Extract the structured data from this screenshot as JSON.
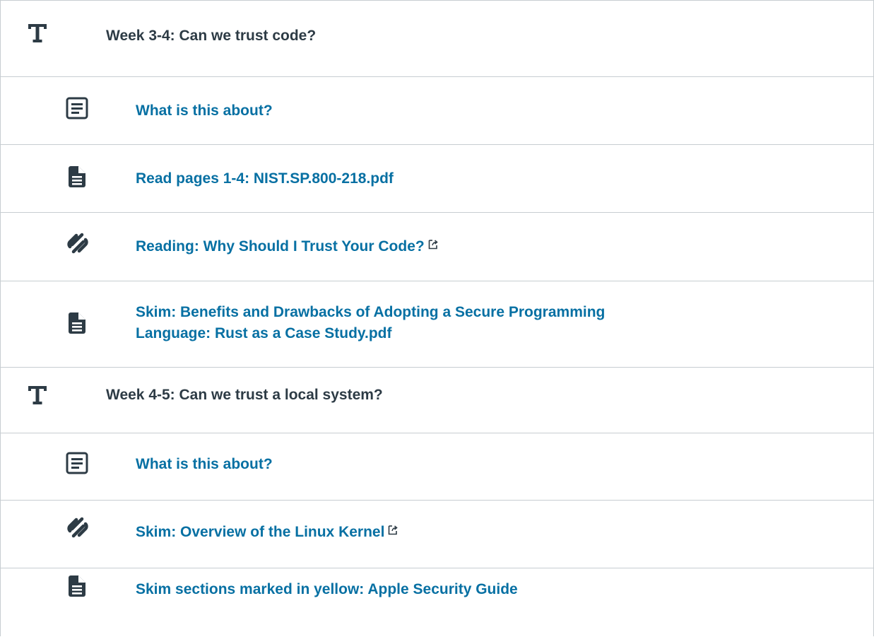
{
  "module": {
    "rows": [
      {
        "kind": "header",
        "icon": "text-header-icon",
        "title": "Week 3-4: Can we trust code?"
      },
      {
        "kind": "item",
        "icon": "page-icon",
        "title": "What is this about?"
      },
      {
        "kind": "item",
        "icon": "file-icon",
        "title": "Read pages 1-4: NIST.SP.800-218.pdf"
      },
      {
        "kind": "item",
        "icon": "external-link-icon",
        "title": "Reading: Why Should I Trust Your Code?",
        "external": true
      },
      {
        "kind": "item",
        "icon": "file-icon",
        "title_line1": "Skim: Benefits and Drawbacks of Adopting a Secure Programming",
        "title_line2": "Language: Rust as a Case Study.pdf"
      },
      {
        "kind": "header",
        "icon": "text-header-icon",
        "title": "Week 4-5: Can we trust a local system?"
      },
      {
        "kind": "item",
        "icon": "page-icon",
        "title": "What is this about?"
      },
      {
        "kind": "item",
        "icon": "external-link-icon",
        "title": "Skim: Overview of the Linux Kernel",
        "external": true
      },
      {
        "kind": "item",
        "icon": "file-icon",
        "title": "Skim sections marked in yellow: Apple Security Guide"
      }
    ]
  },
  "colors": {
    "header_text": "#2d3b45",
    "link_text": "#0770a3",
    "icon": "#2d3b45",
    "border": "#c7cdd1"
  }
}
